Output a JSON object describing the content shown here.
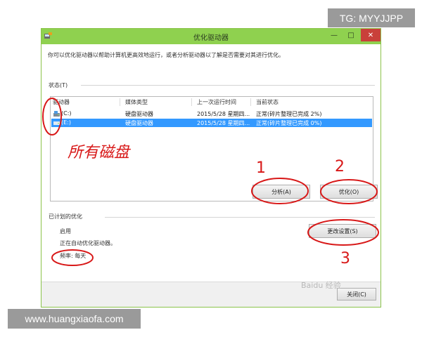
{
  "watermarks": {
    "top": "TG: MYYJJPP",
    "bottom": "www.huangxiaofa.com"
  },
  "window": {
    "title": "优化驱动器",
    "min": "—",
    "max": "□",
    "close": "✕"
  },
  "description": "你可以优化驱动器以帮助计算机更高效地运行，或者分析驱动器以了解是否需要对其进行优化。",
  "status": {
    "label": "状态(T)",
    "columns": [
      "驱动器",
      "媒体类型",
      "上一次运行时间",
      "当前状态"
    ],
    "rows": [
      {
        "drive": "(C:)",
        "media": "硬盘驱动器",
        "last_run": "2015/5/28 星期四...",
        "state": "正常(碎片整理已完成 2%)",
        "selected": false
      },
      {
        "drive": "(E:)",
        "media": "硬盘驱动器",
        "last_run": "2015/5/28 星期四...",
        "state": "正常(碎片整理已完成 0%)",
        "selected": true
      }
    ]
  },
  "buttons": {
    "analyze": "分析(A)",
    "optimize": "优化(O)",
    "change_settings": "更改设置(S)",
    "close": "关闭(C)"
  },
  "scheduled": {
    "label": "已计划的优化",
    "state": "启用",
    "detail": "正在自动优化驱动器。",
    "frequency": "频率: 每天"
  },
  "annotations": {
    "all_disks": "所有磁盘",
    "num1": "1",
    "num2": "2",
    "num3": "3"
  },
  "brand_watermark": "Baidu 经验",
  "colors": {
    "titlebar": "#8fd14f",
    "selection": "#3399ff",
    "annotation": "#d81818",
    "close_button": "#c9403a"
  },
  "icons": {
    "app": "defrag-app-icon",
    "drive": "hard-drive-icon"
  }
}
